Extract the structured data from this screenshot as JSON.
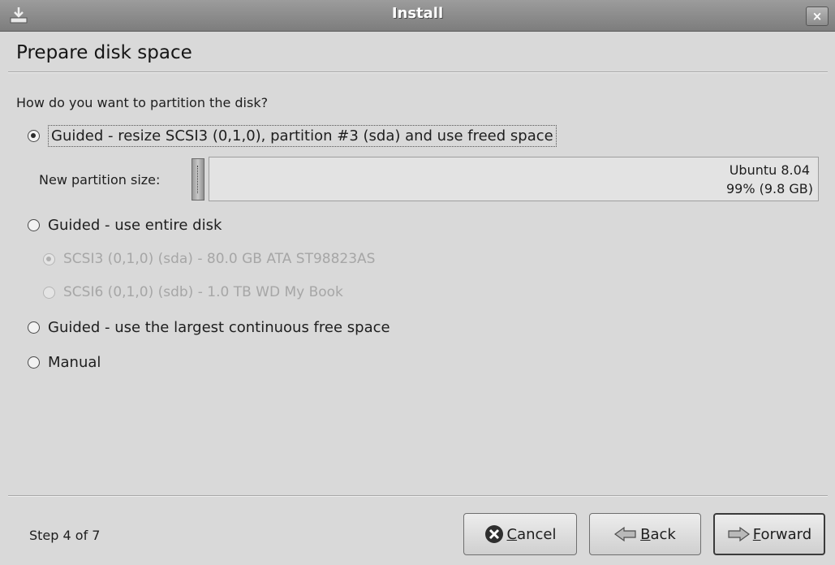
{
  "window": {
    "title": "Install",
    "close_label": "×"
  },
  "page": {
    "heading": "Prepare disk space",
    "question": "How do you want to partition the disk?"
  },
  "options": {
    "resize": "Guided - resize SCSI3 (0,1,0), partition #3 (sda) and use freed space",
    "entire": "Guided - use entire disk",
    "disk_sda": "SCSI3 (0,1,0) (sda) - 80.0 GB ATA ST98823AS",
    "disk_sdb": "SCSI6 (0,1,0) (sdb) - 1.0 TB WD My Book",
    "largest": "Guided - use the largest continuous free space",
    "manual": "Manual",
    "selected": "resize",
    "selected_disk": "sda"
  },
  "partition": {
    "size_label": "New partition size:",
    "name": "Ubuntu 8.04",
    "size": "99% (9.8 GB)",
    "fraction": 0.99
  },
  "footer": {
    "step": "Step 4 of 7",
    "cancel_first": "C",
    "cancel_rest": "ancel",
    "back_first": "B",
    "back_rest": "ack",
    "forward_first": "F",
    "forward_rest": "orward"
  },
  "icons": {
    "window": "install-icon",
    "cancel": "cancel-icon",
    "back": "back-arrow-icon",
    "forward": "forward-arrow-icon"
  }
}
